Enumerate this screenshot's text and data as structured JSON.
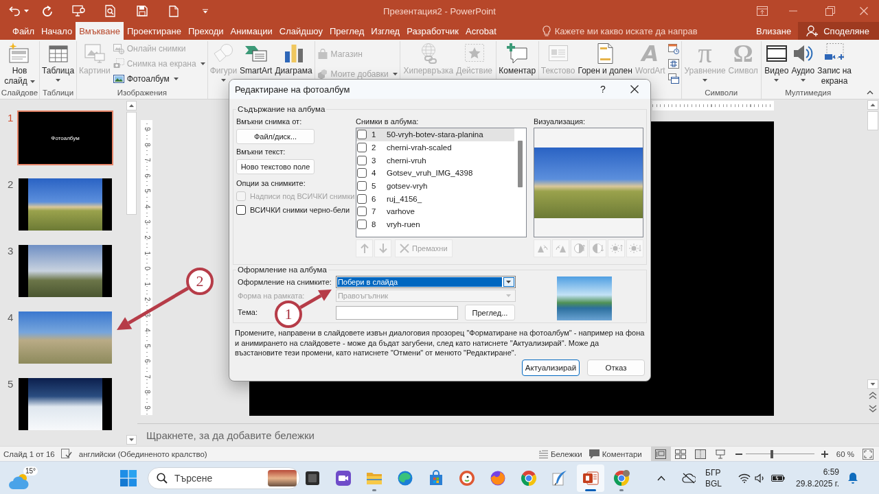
{
  "window": {
    "title": "Презентация2 - PowerPoint"
  },
  "tabs": [
    {
      "label": "Файл",
      "selected": false
    },
    {
      "label": "Начало",
      "selected": false
    },
    {
      "label": "Вмъкване",
      "selected": true
    },
    {
      "label": "Проектиране",
      "selected": false
    },
    {
      "label": "Преходи",
      "selected": false
    },
    {
      "label": "Анимации",
      "selected": false
    },
    {
      "label": "Слайдшоу",
      "selected": false
    },
    {
      "label": "Преглед",
      "selected": false
    },
    {
      "label": "Изглед",
      "selected": false
    },
    {
      "label": "Разработчик",
      "selected": false
    },
    {
      "label": "Acrobat",
      "selected": false
    }
  ],
  "tell_me": {
    "placeholder": "Кажете ми какво искате да направ"
  },
  "account": {
    "sign_in": "Влизане",
    "share": "Споделяне"
  },
  "ribbon": {
    "groups": [
      {
        "label": "Слайдове",
        "commands": [
          {
            "kind": "split",
            "label": "Нов\nслайд",
            "disabled": false,
            "dropdown": true
          }
        ]
      },
      {
        "label": "Таблици",
        "commands": [
          {
            "kind": "large",
            "label": "Таблица",
            "disabled": false,
            "dropdown": true
          }
        ]
      },
      {
        "label": "Изображения",
        "commands": [
          {
            "kind": "large",
            "label": "Картини",
            "disabled": true,
            "dropdown": false
          },
          {
            "kind": "small",
            "label": "Онлайн снимки",
            "disabled": true,
            "dropdown": false
          },
          {
            "kind": "small",
            "label": "Снимка на екрана",
            "disabled": true,
            "dropdown": true
          },
          {
            "kind": "small",
            "label": "Фотоалбум",
            "disabled": false,
            "dropdown": true
          }
        ]
      },
      {
        "commands": [
          {
            "kind": "large",
            "label": "Фигури",
            "disabled": true,
            "dropdown": true
          },
          {
            "kind": "large",
            "label": "SmartArt",
            "disabled": false,
            "dropdown": false
          },
          {
            "kind": "large",
            "label": "Диаграма",
            "disabled": false,
            "dropdown": false
          }
        ]
      },
      {
        "commands": [
          {
            "kind": "small",
            "label": "Магазин",
            "disabled": true,
            "dropdown": false
          },
          {
            "kind": "small",
            "label": "Моите добавки",
            "disabled": true,
            "dropdown": true
          }
        ]
      },
      {
        "commands": [
          {
            "kind": "large",
            "label": "Хипервръзка",
            "disabled": true,
            "dropdown": false
          },
          {
            "kind": "large",
            "label": "Действие",
            "disabled": true,
            "dropdown": false
          }
        ]
      },
      {
        "commands": [
          {
            "kind": "large",
            "label": "Коментар",
            "disabled": false,
            "dropdown": false
          }
        ]
      },
      {
        "commands": [
          {
            "kind": "large",
            "label": "Текстово",
            "disabled": true,
            "dropdown": false
          },
          {
            "kind": "large",
            "label": "Горен и долен",
            "disabled": false,
            "dropdown": false
          },
          {
            "kind": "large",
            "label": "WordArt",
            "glyph": "A",
            "disabled": true,
            "dropdown": false
          },
          {
            "kind": "icon",
            "disabled": false
          },
          {
            "kind": "icon",
            "disabled": false
          },
          {
            "kind": "icon",
            "disabled": false
          }
        ]
      },
      {
        "label": "Символи",
        "commands": [
          {
            "kind": "large",
            "label": "Уравнение",
            "glyph": "π",
            "disabled": true,
            "dropdown": true
          },
          {
            "kind": "large",
            "label": "Символ",
            "glyph": "Ω",
            "disabled": true,
            "dropdown": false
          }
        ]
      },
      {
        "label": "Мултимедия",
        "commands": [
          {
            "kind": "large",
            "label": "Видео",
            "disabled": false,
            "dropdown": true
          },
          {
            "kind": "large",
            "label": "Аудио",
            "disabled": false,
            "dropdown": true
          },
          {
            "kind": "large",
            "label": "Запис на\nекрана",
            "disabled": false,
            "dropdown": false
          }
        ]
      }
    ]
  },
  "slides": [
    {
      "number": "1",
      "kind": "title",
      "title": "Фотоалбум",
      "selected": true
    },
    {
      "number": "2",
      "kind": "narrow",
      "selected": false
    },
    {
      "number": "3",
      "kind": "narrow",
      "selected": false
    },
    {
      "number": "4",
      "kind": "wide",
      "selected": false
    },
    {
      "number": "5",
      "kind": "narrow",
      "selected": false
    }
  ],
  "vertical_ruler": [
    "9",
    "8",
    "7",
    "6",
    "5",
    "4",
    "3",
    "2",
    "1",
    "0",
    "1",
    "2",
    "3",
    "4",
    "5",
    "6",
    "7",
    "8",
    "9"
  ],
  "notes": {
    "placeholder": "Щракнете, за да добавите бележки"
  },
  "dialog": {
    "title": "Редактиране на фотоалбум",
    "help": "?",
    "album_content": {
      "legend": "Съдържание на албума",
      "insert_picture_label": "Вмъкни снимка от:",
      "file_button": "Файл/диск...",
      "insert_text_label": "Вмъкни текст:",
      "text_box_button": "Ново текстово поле",
      "options_label": "Опции за снимките:",
      "options": [
        {
          "label": "Надписи под ВСИЧКИ снимки",
          "checked": false,
          "disabled": true
        },
        {
          "label": "ВСИЧКИ снимки черно-бели",
          "checked": false,
          "disabled": false
        }
      ],
      "pictures_label": "Снимки в албума:",
      "pictures": [
        {
          "number": "1",
          "name": "50-vryh-botev-stara-planina",
          "checked": false,
          "selected": true
        },
        {
          "number": "2",
          "name": "cherni-vrah-scaled",
          "checked": false,
          "selected": false
        },
        {
          "number": "3",
          "name": "cherni-vruh",
          "checked": false,
          "selected": false
        },
        {
          "number": "4",
          "name": "Gotsev_vruh_IMG_4398",
          "checked": false,
          "selected": false
        },
        {
          "number": "5",
          "name": "gotsev-vryh",
          "checked": false,
          "selected": false
        },
        {
          "number": "6",
          "name": "ruj_4156_",
          "checked": false,
          "selected": false
        },
        {
          "number": "7",
          "name": "varhove",
          "checked": false,
          "selected": false
        },
        {
          "number": "8",
          "name": "vryh-ruen",
          "checked": false,
          "selected": false
        }
      ],
      "list_buttons": [
        {
          "kind": "up",
          "disabled": true
        },
        {
          "kind": "down",
          "disabled": true
        },
        {
          "kind": "remove",
          "label": "Премахни",
          "disabled": true
        }
      ],
      "preview_label": "Визуализация:",
      "image_tools": [
        {
          "disabled": true
        },
        {
          "disabled": true
        },
        {
          "disabled": true
        },
        {
          "disabled": true
        },
        {
          "disabled": true
        },
        {
          "disabled": true
        }
      ]
    },
    "album_layout": {
      "legend": "Оформление на албума",
      "picture_layout": {
        "label": "Оформление на снимките:",
        "value": "Побери в слайда",
        "disabled": false,
        "focused": true
      },
      "frame_shape": {
        "label": "Форма на рамката:",
        "value": "Правоъгълник",
        "disabled": true,
        "focused": false
      },
      "theme": {
        "label": "Тема:",
        "button": "Преглед..."
      }
    },
    "note": "Промените, направени в слайдовете извън диалоговия прозорец \"Форматиране на фотоалбум\" - например на фона и анимирането на слайдовете - може да бъдат загубени, след като натиснете \"Актуализирай\". Може да възстановите тези промени, като натиснете \"Отмени\" от менюто \"Редактиране\".",
    "buttons": [
      {
        "label": "Актуализирай",
        "default": true
      },
      {
        "label": "Отказ",
        "default": false
      }
    ]
  },
  "annotations": [
    {
      "number": "1"
    },
    {
      "number": "2"
    }
  ],
  "status_bar": {
    "slide_info": "Слайд 1 от 16",
    "language": "английски (Обединеното кралство)",
    "notes": "Бележки",
    "comments": "Коментари",
    "views": [
      {
        "selected": true
      },
      {
        "selected": false
      },
      {
        "selected": false
      },
      {
        "selected": false
      }
    ],
    "zoom": {
      "level": 0.38,
      "reading": "60 %"
    }
  },
  "taskbar": {
    "weather": "15°",
    "search": {
      "placeholder": "Търсене"
    },
    "apps": [
      {
        "running": false,
        "selected": false
      },
      {
        "running": false,
        "selected": false
      },
      {
        "running": true,
        "selected": false
      },
      {
        "running": false,
        "selected": false
      },
      {
        "running": false,
        "selected": false
      },
      {
        "running": false,
        "selected": false
      },
      {
        "running": false,
        "selected": false
      },
      {
        "running": false,
        "selected": false
      },
      {
        "running": false,
        "selected": false
      },
      {
        "running": true,
        "selected": true
      },
      {
        "running": true,
        "selected": false
      }
    ],
    "input_language": [
      "БГР",
      "BGL"
    ],
    "time": "6:59",
    "date": "29.8.2025 г."
  }
}
